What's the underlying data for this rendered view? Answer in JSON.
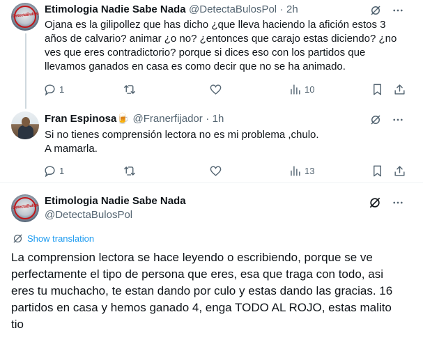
{
  "tweets": [
    {
      "name": "Etimologia Nadie Sabe Nada",
      "handle": "@DetectaBulosPol",
      "time": "2h",
      "lines": [
        "Ojana es la gilipollez que has dicho ¿que lleva haciendo la afición estos 3",
        "años de calvario? animar ¿o no? ¿entonces que carajo estas diciendo? ¿no",
        "ves que eres contradictorio? porque si dices eso con los partidos que",
        "llevamos ganados en casa es como decir que no se ha animado."
      ],
      "replies": "1",
      "views": "10"
    },
    {
      "name": "Fran Espinosa🍺",
      "handle": "@Franerfijador",
      "time": "1h",
      "lines": [
        "Si no tienes comprensión lectora no es mi problema ,chulo.",
        "A mamarla."
      ],
      "replies": "1",
      "views": "13"
    }
  ],
  "main_tweet": {
    "name": "Etimologia Nadie Sabe Nada",
    "handle": "@DetectaBulosPol",
    "translate_label": "Show translation",
    "lines": [
      "La comprension lectora se hace leyendo o escribiendo, porque se ve",
      "perfectamente el tipo de persona que eres, esa que traga con todo, asi",
      "eres tu muchacho, te estan dando por culo y estas dando las gracias. 16",
      "partidos en casa y hemos ganado 4, enga TODO AL ROJO, estas malito",
      "tio"
    ]
  },
  "dot": "·",
  "avatar_logo_text": "DetectaBulosPol",
  "icons": {
    "grok": "grok-icon",
    "more": "more-icon",
    "reply": "reply-icon",
    "retweet": "retweet-icon",
    "like": "like-icon",
    "views": "views-icon",
    "bookmark": "bookmark-icon",
    "share": "share-icon",
    "translate": "translate-icon"
  },
  "colors": {
    "text": "#0f1419",
    "secondary": "#536471",
    "link": "#1d9bf0",
    "divider": "#eff3f4"
  }
}
